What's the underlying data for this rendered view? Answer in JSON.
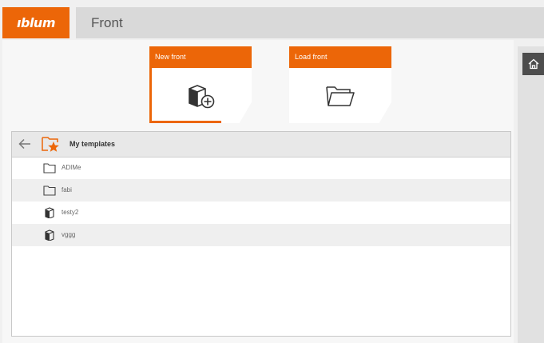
{
  "brand": {
    "logo_text": "ıblum"
  },
  "header": {
    "title": "Front"
  },
  "cards": [
    {
      "label": "New front",
      "icon": "add-cube-icon",
      "active": true
    },
    {
      "label": "Load front",
      "icon": "open-folder-icon",
      "active": false
    }
  ],
  "templates": {
    "title": "My templates",
    "items": [
      {
        "label": "ADIMe",
        "icon": "folder-icon"
      },
      {
        "label": "fabi",
        "icon": "folder-icon"
      },
      {
        "label": "testy2",
        "icon": "cube-icon"
      },
      {
        "label": "vggg",
        "icon": "cube-icon"
      }
    ]
  },
  "colors": {
    "accent": "#ec6608",
    "header_bg": "#d9d9d9",
    "home_button": "#4d4d4d"
  }
}
